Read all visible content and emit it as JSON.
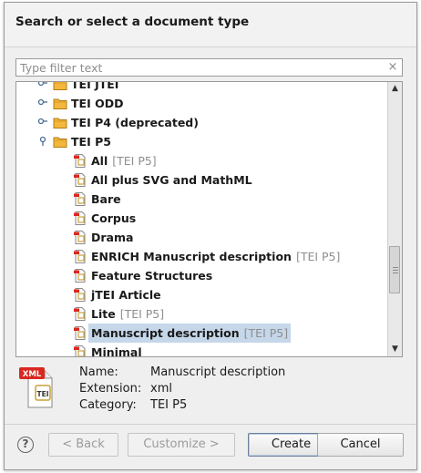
{
  "dialog": {
    "title": "Search or select a document type"
  },
  "filter": {
    "placeholder": "Type filter text",
    "value": "",
    "clear_icon": "×"
  },
  "tree": {
    "rows": [
      {
        "type": "folder",
        "expander": "collapsed",
        "label": "TEI JTEI",
        "tag": "",
        "partial": true
      },
      {
        "type": "folder",
        "expander": "collapsed",
        "label": "TEI ODD",
        "tag": ""
      },
      {
        "type": "folder",
        "expander": "collapsed",
        "label": "TEI P4 (deprecated)",
        "tag": ""
      },
      {
        "type": "folder",
        "expander": "expanded",
        "label": "TEI P5",
        "tag": ""
      },
      {
        "type": "doc",
        "label": "All",
        "tag": "[TEI P5]"
      },
      {
        "type": "doc",
        "label": "All plus SVG and MathML",
        "tag": ""
      },
      {
        "type": "doc",
        "label": "Bare",
        "tag": ""
      },
      {
        "type": "doc",
        "label": "Corpus",
        "tag": ""
      },
      {
        "type": "doc",
        "label": "Drama",
        "tag": ""
      },
      {
        "type": "doc",
        "label": "ENRICH Manuscript description",
        "tag": "[TEI P5]"
      },
      {
        "type": "doc",
        "label": "Feature Structures",
        "tag": ""
      },
      {
        "type": "doc",
        "label": "jTEI Article",
        "tag": ""
      },
      {
        "type": "doc",
        "label": "Lite",
        "tag": "[TEI P5]"
      },
      {
        "type": "doc",
        "label": "Manuscript description",
        "tag": "[TEI P5]",
        "selected": true
      },
      {
        "type": "doc",
        "label": "Minimal",
        "tag": ""
      }
    ],
    "scroll_up_icon": "▲",
    "scroll_down_icon": "▼"
  },
  "details": {
    "icon_badge": "XML",
    "icon_label": "TEI",
    "name_key": "Name:",
    "name_value": "Manuscript description",
    "extension_key": "Extension:",
    "extension_value": "xml",
    "category_key": "Category:",
    "category_value": "TEI P5"
  },
  "buttons": {
    "help": "?",
    "back": "< Back",
    "customize": "Customize >",
    "create": "Create",
    "cancel": "Cancel"
  },
  "colors": {
    "selection": "#c6d7ea",
    "folder": "#f3b73d",
    "xml_badge": "#d9281f",
    "tag_gray": "#8e8e8e"
  }
}
